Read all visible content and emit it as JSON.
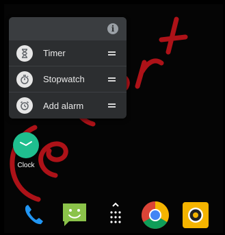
{
  "popup": {
    "info_icon": "info-icon",
    "items": [
      {
        "label": "Timer",
        "icon": "hourglass-icon"
      },
      {
        "label": "Stopwatch",
        "icon": "stopwatch-icon"
      },
      {
        "label": "Add alarm",
        "icon": "alarm-clock-icon"
      }
    ]
  },
  "app": {
    "label": "Clock",
    "icon": "clock-icon",
    "color": "#1fbf8f"
  },
  "dock": {
    "items": [
      {
        "icon": "phone-icon",
        "color": "#2196f3"
      },
      {
        "icon": "messaging-icon",
        "color": "#8bc34a"
      },
      {
        "icon": "app-drawer-icon",
        "color": "#ffffff"
      },
      {
        "icon": "chrome-icon",
        "color": "#db4437"
      },
      {
        "icon": "camera-icon",
        "color": "#f5b400"
      }
    ]
  },
  "colors": {
    "background": "#050505",
    "popup_background": "#2c2e30",
    "popup_header": "#3a3d40",
    "watermark": "#c0141b"
  }
}
